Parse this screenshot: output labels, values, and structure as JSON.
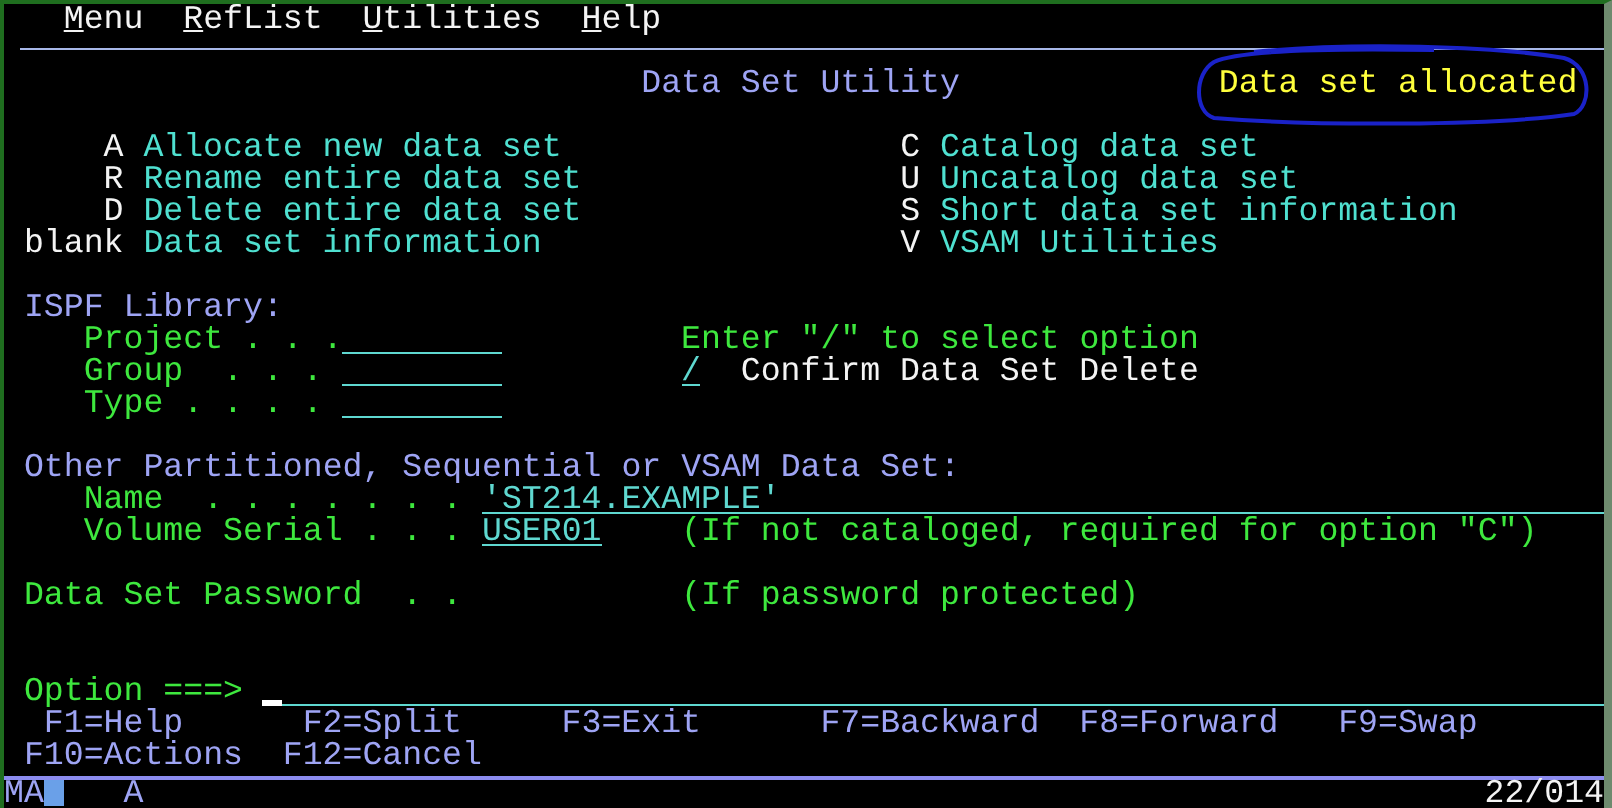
{
  "menu_bar": [
    {
      "label": "Menu"
    },
    {
      "label": "RefList"
    },
    {
      "label": "Utilities"
    },
    {
      "label": "Help"
    }
  ],
  "panel": {
    "title": "Data Set Utility",
    "message": "Data set allocated",
    "message_circled": true
  },
  "options_left": [
    {
      "key": "A",
      "label": "Allocate new data set"
    },
    {
      "key": "R",
      "label": "Rename entire data set"
    },
    {
      "key": "D",
      "label": "Delete entire data set"
    },
    {
      "key": "blank",
      "label": "Data set information"
    }
  ],
  "options_right": [
    {
      "key": "C",
      "label": "Catalog data set"
    },
    {
      "key": "U",
      "label": "Uncatalog data set"
    },
    {
      "key": "S",
      "label": "Short data set information"
    },
    {
      "key": "V",
      "label": "VSAM Utilities"
    }
  ],
  "ispf_library": {
    "heading": "ISPF Library:",
    "fields": [
      {
        "label": "Project . . ."
      },
      {
        "label": "Group  . . ."
      },
      {
        "label": "Type . . . ."
      }
    ]
  },
  "select_options": {
    "instruction": "Enter \"/\" to select option",
    "items": [
      {
        "value": "/",
        "label": "Confirm Data Set Delete"
      }
    ]
  },
  "other_data_set": {
    "heading": "Other Partitioned, Sequential or VSAM Data Set:",
    "fields": [
      {
        "label": "Name  . . . . . . .",
        "value": "'ST214.EXAMPLE'"
      },
      {
        "label": "Volume Serial . . .",
        "value": "USER01",
        "note": "(If not cataloged, required for option \"C\")"
      }
    ]
  },
  "password": {
    "label": "Data Set Password  . .",
    "note": "(If password protected)"
  },
  "command": {
    "label": "Option ===>"
  },
  "function_keys": [
    [
      "F1=Help",
      "F2=Split",
      "F3=Exit",
      "F7=Backward",
      "F8=Forward",
      "F9=Swap"
    ],
    [
      "F10=Actions",
      "F12=Cancel"
    ]
  ],
  "status_bar": {
    "session": "MA",
    "mode": "A",
    "position": "22/014"
  }
}
